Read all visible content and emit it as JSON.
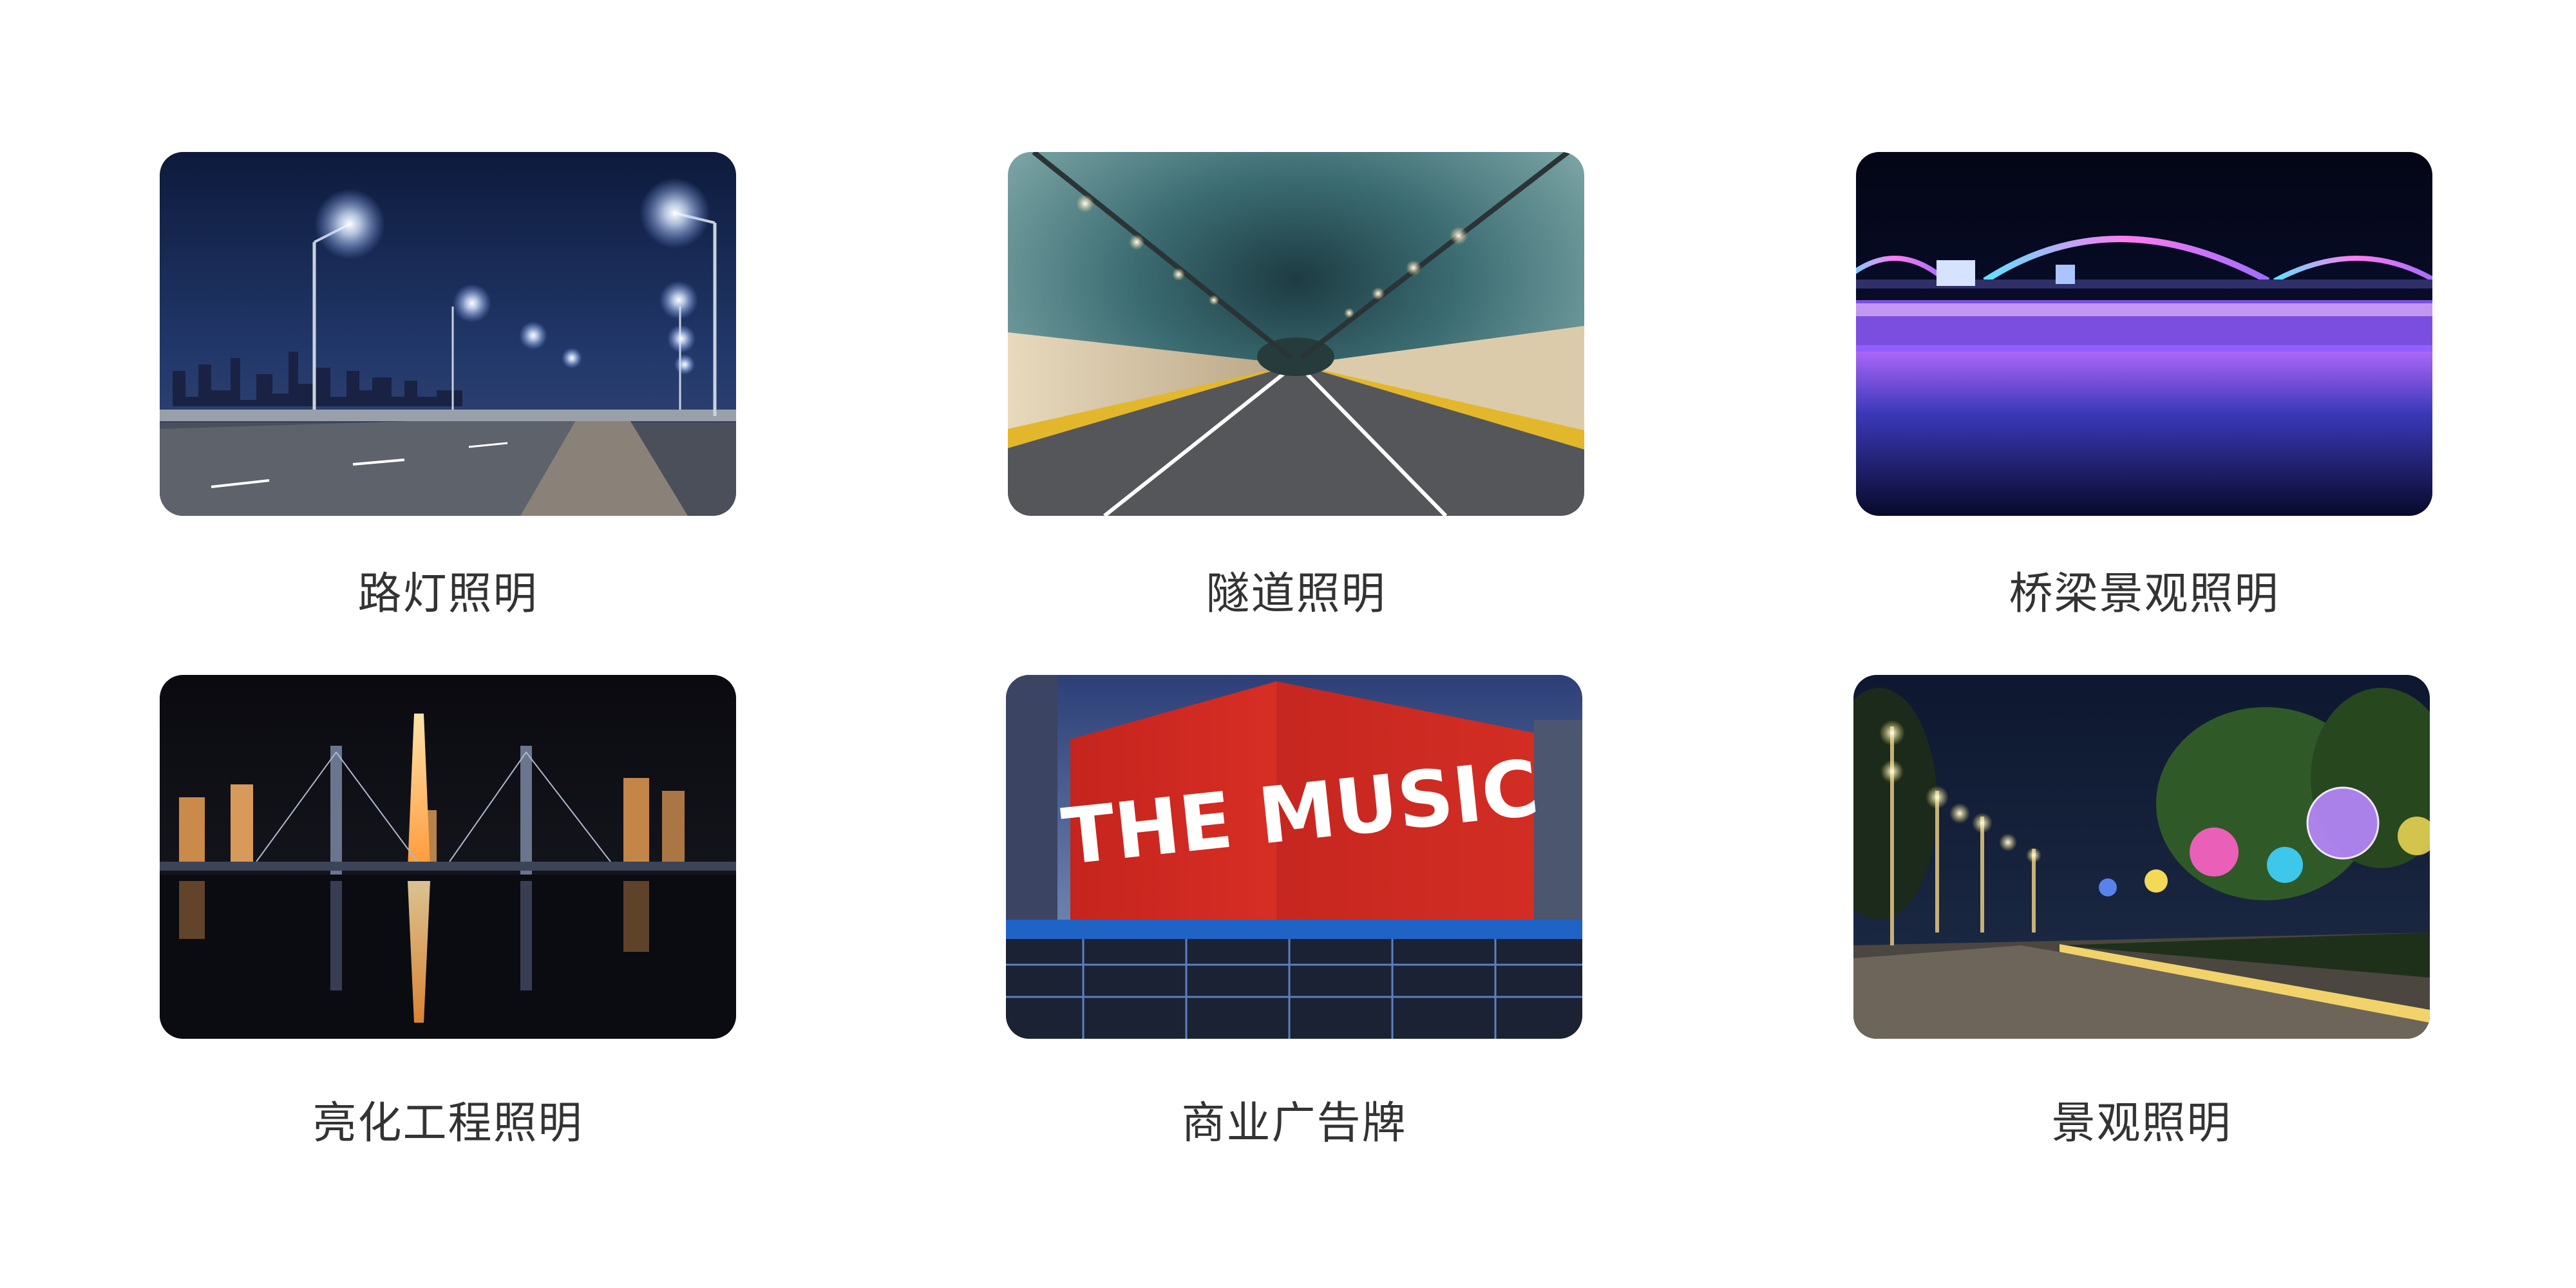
{
  "cards": [
    {
      "label": "路灯照明",
      "image": "night-street-lights-bridge-road"
    },
    {
      "label": "隧道照明",
      "image": "illuminated-road-tunnel"
    },
    {
      "label": "桥梁景观照明",
      "image": "rainbow-lit-arch-bridge-over-river"
    },
    {
      "label": "亮化工程照明",
      "image": "city-skyline-night-reflection"
    },
    {
      "label": "商业广告牌",
      "image": "large-led-billboard-building"
    },
    {
      "label": "景观照明",
      "image": "garden-path-landscape-lights"
    }
  ],
  "billboard": {
    "text": "THE MUSIC"
  }
}
